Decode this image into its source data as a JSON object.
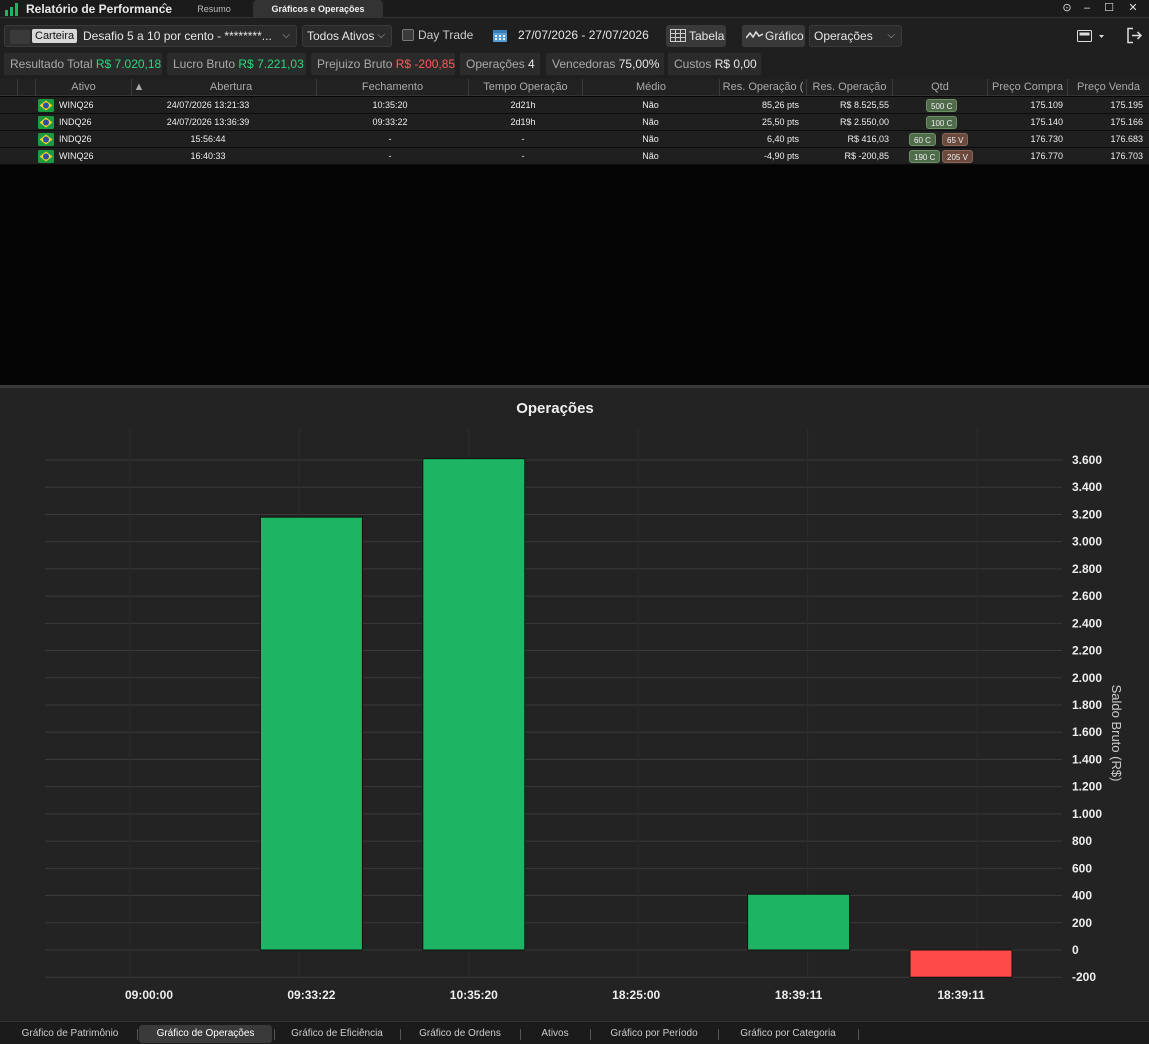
{
  "app": {
    "title": "Relatório de Performance",
    "tabs": [
      {
        "label": "Resumo",
        "active": false
      },
      {
        "label": "Gráficos e Operações",
        "active": true
      }
    ]
  },
  "toolbar": {
    "carteira_label": "Carteira",
    "carteira_value": "Desafio 5 a 10 por cento  - ********...",
    "assets_select": "Todos Ativos",
    "day_trade_label": "Day Trade",
    "date_range": "27/07/2026 - 27/07/2026",
    "table_button": "Tabela",
    "chart_button": "Gráfico",
    "chart_type_select": "Operações"
  },
  "summary": [
    {
      "label": "Resultado Total",
      "value": "R$ 7.020,18",
      "tone": "pos"
    },
    {
      "label": "Lucro Bruto",
      "value": "R$ 7.221,03",
      "tone": "pos"
    },
    {
      "label": "Prejuizo Bruto",
      "value": "R$ -200,85",
      "tone": "neg"
    },
    {
      "label": "Operações",
      "value": "4",
      "tone": "neutral"
    },
    {
      "label": "Vencedoras",
      "value": "75,00%",
      "tone": "neutral"
    },
    {
      "label": "Custos",
      "value": "R$ 0,00",
      "tone": "neutral"
    }
  ],
  "table": {
    "headers": [
      "Ativo",
      "Abertura",
      "Fechamento",
      "Tempo Operação",
      "Médio",
      "Res. Operação (",
      "Res. Operação",
      "Qtd",
      "Preço Compra",
      "Preço Venda"
    ],
    "rows": [
      {
        "ativo": "WINQ26",
        "abertura": "24/07/2026 13:21:33",
        "fechamento": "10:35:20",
        "tempo": "2d21h",
        "medio": "Não",
        "res_pts": "85,26 pts",
        "res_rs": "R$ 8.525,55",
        "tone": "pos",
        "qtd_c": "500 C",
        "qtd_v": "",
        "preco_compra": "175.109",
        "preco_venda": "175.195"
      },
      {
        "ativo": "INDQ26",
        "abertura": "24/07/2026 13:36:39",
        "fechamento": "09:33:22",
        "tempo": "2d19h",
        "medio": "Não",
        "res_pts": "25,50 pts",
        "res_rs": "R$ 2.550,00",
        "tone": "pos",
        "qtd_c": "100 C",
        "qtd_v": "",
        "preco_compra": "175.140",
        "preco_venda": "175.166"
      },
      {
        "ativo": "INDQ26",
        "abertura": "15:56:44",
        "fechamento": "-",
        "tempo": "-",
        "medio": "Não",
        "res_pts": "6,40 pts",
        "res_rs": "R$ 416,03",
        "tone": "pos",
        "qtd_c": "60 C",
        "qtd_v": "65 V",
        "preco_compra": "176.730",
        "preco_venda": "176.683"
      },
      {
        "ativo": "WINQ26",
        "abertura": "16:40:33",
        "fechamento": "-",
        "tempo": "-",
        "medio": "Não",
        "res_pts": "-4,90 pts",
        "res_rs": "R$ -200,85",
        "tone": "neg",
        "qtd_c": "190 C",
        "qtd_v": "205 V",
        "preco_compra": "176.770",
        "preco_venda": "176.703"
      }
    ]
  },
  "chart_data": {
    "type": "bar",
    "title": "Operações",
    "ylabel": "Saldo Bruto (R$)",
    "xlabel": "",
    "categories": [
      "09:00:00",
      "09:33:22",
      "10:35:20",
      "18:25:00",
      "18:39:11",
      "18:39:11"
    ],
    "values": [
      null,
      3180,
      3610,
      null,
      410,
      -200
    ],
    "ylim": [
      -200,
      3600
    ],
    "yticks": [
      -200,
      0,
      200,
      400,
      600,
      800,
      1000,
      1200,
      1400,
      1600,
      1800,
      2000,
      2200,
      2400,
      2600,
      2800,
      3000,
      3200,
      3400,
      3600
    ],
    "ytick_labels": [
      "-200",
      "0",
      "200",
      "400",
      "600",
      "800",
      "1.000",
      "1.200",
      "1.400",
      "1.600",
      "1.800",
      "2.000",
      "2.200",
      "2.400",
      "2.600",
      "2.800",
      "3.000",
      "3.200",
      "3.400",
      "3.600"
    ],
    "grid": true,
    "colors": {
      "positive": "#1db463",
      "negative": "#ff4a4a"
    }
  },
  "bottom_tabs": [
    {
      "label": "Gráfico de Patrimônio",
      "active": false
    },
    {
      "label": "Gráfico de Operações",
      "active": true
    },
    {
      "label": "Gráfico de Eficiência",
      "active": false
    },
    {
      "label": "Gráfico de Ordens",
      "active": false
    },
    {
      "label": "Ativos",
      "active": false
    },
    {
      "label": "Gráfico por Período",
      "active": false
    },
    {
      "label": "Gráfico por Categoria",
      "active": false
    }
  ]
}
